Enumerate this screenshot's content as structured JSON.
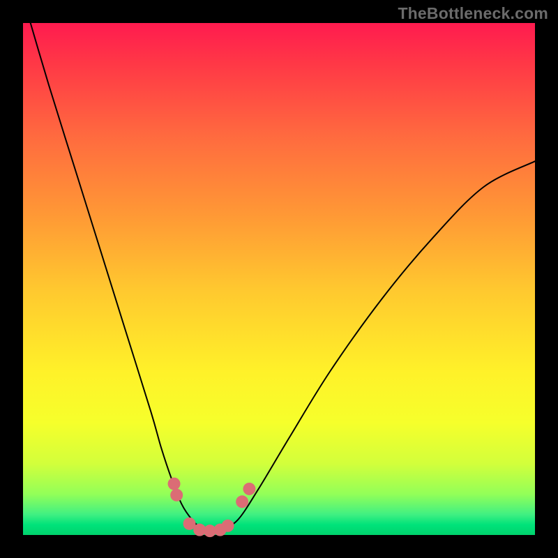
{
  "watermark": {
    "text": "TheBottleneck.com"
  },
  "chart_data": {
    "type": "line",
    "title": "",
    "xlabel": "",
    "ylabel": "",
    "xlim": [
      0,
      100
    ],
    "ylim": [
      0,
      100
    ],
    "grid": false,
    "legend": false,
    "series": [
      {
        "name": "bottleneck-curve",
        "x": [
          0,
          5,
          10,
          15,
          20,
          25,
          27,
          29,
          31,
          33,
          35,
          37,
          39,
          42,
          46,
          52,
          60,
          70,
          80,
          90,
          100
        ],
        "y": [
          105,
          88,
          72,
          56,
          40,
          24,
          17,
          11,
          6,
          3,
          1.2,
          0.6,
          1.2,
          3,
          9,
          19,
          32,
          46,
          58,
          68,
          73
        ]
      }
    ],
    "markers": [
      {
        "name": "bead-left-upper",
        "x": 29.5,
        "y": 10.0
      },
      {
        "name": "bead-left-lower",
        "x": 30.0,
        "y": 7.8
      },
      {
        "name": "bead-bottom-1",
        "x": 32.5,
        "y": 2.2
      },
      {
        "name": "bead-bottom-2",
        "x": 34.5,
        "y": 1.0
      },
      {
        "name": "bead-bottom-3",
        "x": 36.5,
        "y": 0.8
      },
      {
        "name": "bead-bottom-4",
        "x": 38.5,
        "y": 1.0
      },
      {
        "name": "bead-bottom-5",
        "x": 40.0,
        "y": 1.8
      },
      {
        "name": "bead-right-lower",
        "x": 42.8,
        "y": 6.5
      },
      {
        "name": "bead-right-upper",
        "x": 44.2,
        "y": 9.0
      }
    ],
    "background_gradient": {
      "top": "#ff1b4f",
      "mid": "#fff129",
      "bottom": "#00d36d"
    }
  }
}
